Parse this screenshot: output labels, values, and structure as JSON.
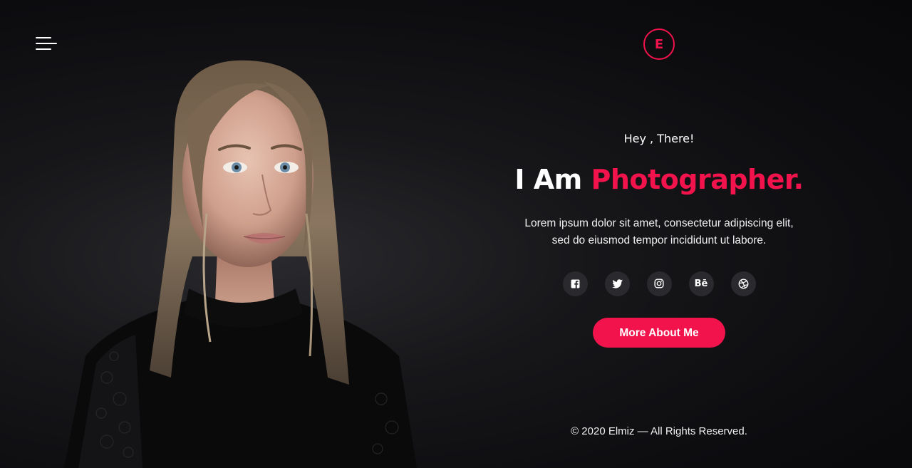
{
  "header": {
    "logo_letter": "E"
  },
  "hero": {
    "greeting": "Hey , There!",
    "headline_prefix": "I Am",
    "headline_accent": "Photographer.",
    "description": "Lorem ipsum dolor sit amet, consectetur adipiscing elit, sed do eiusmod tempor incididunt ut labore.",
    "cta_label": "More About Me"
  },
  "socials": [
    {
      "icon": "facebook-icon"
    },
    {
      "icon": "twitter-icon"
    },
    {
      "icon": "instagram-icon"
    },
    {
      "icon": "behance-icon",
      "label": "Bē"
    },
    {
      "icon": "dribbble-icon"
    }
  ],
  "footer": {
    "copyright": "© 2020 Elmiz — All Rights Reserved."
  },
  "colors": {
    "accent": "#f2134c",
    "background": "#0c0c0f",
    "social_bg": "#2a2a2e"
  }
}
